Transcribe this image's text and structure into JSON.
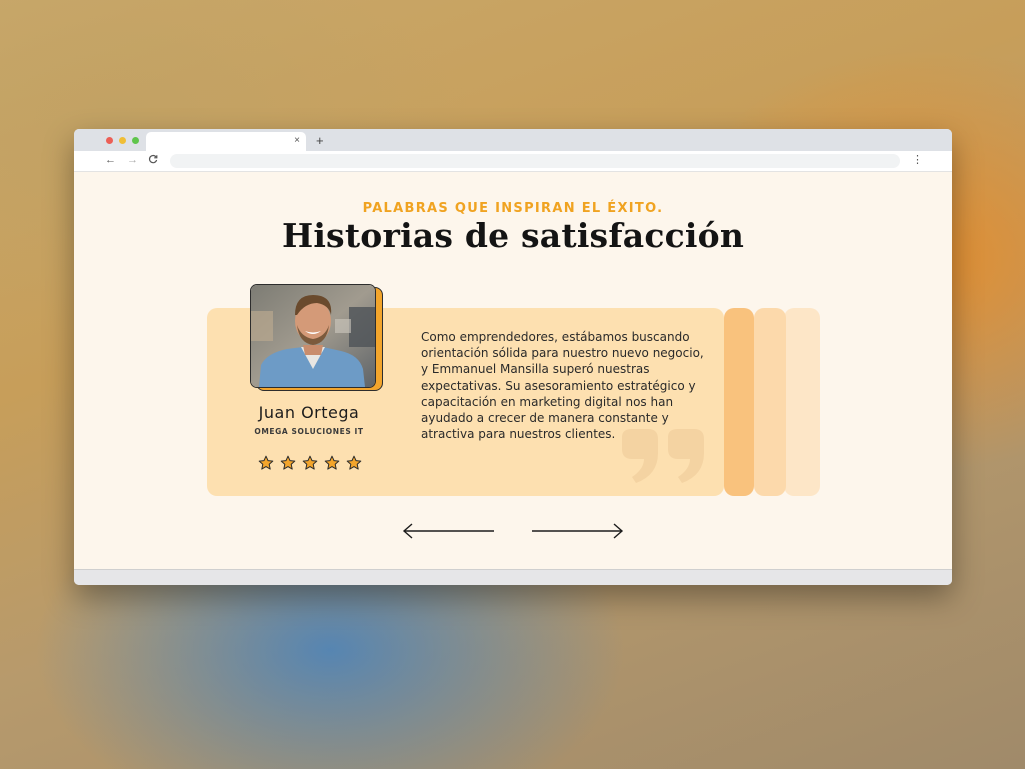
{
  "browser": {
    "tab_title": "",
    "tab_close_glyph": "×",
    "new_tab_glyph": "+",
    "back_glyph": "←",
    "forward_glyph": "→",
    "reload_glyph": "C",
    "menu_glyph": "⋮",
    "url": ""
  },
  "section": {
    "eyebrow": "PALABRAS QUE INSPIRAN EL ÉXITO.",
    "title": "Historias de satisfacción"
  },
  "testimonial": {
    "author_name": "Juan Ortega",
    "company": "OMEGA SOLUCIONES IT",
    "rating": 5,
    "rating_max": 5,
    "quote": "Como emprendedores, estábamos buscando orientación sólida para nuestro nuevo negocio, y Emmanuel Mansilla superó nuestras expectativas. Su asesoramiento estratégico y capacitación en marketing digital nos han ayudado a crecer de manera constante y atractiva para nuestros clientes."
  },
  "icons": {
    "star": "star-icon",
    "quote": "quote-mark-icon",
    "prev": "arrow-left-icon",
    "next": "arrow-right-icon"
  },
  "colors": {
    "accent": "#f0a321",
    "page_bg": "#fdf6ec",
    "card_bg": "#fde0b0",
    "star_fill": "#f3a52c"
  }
}
